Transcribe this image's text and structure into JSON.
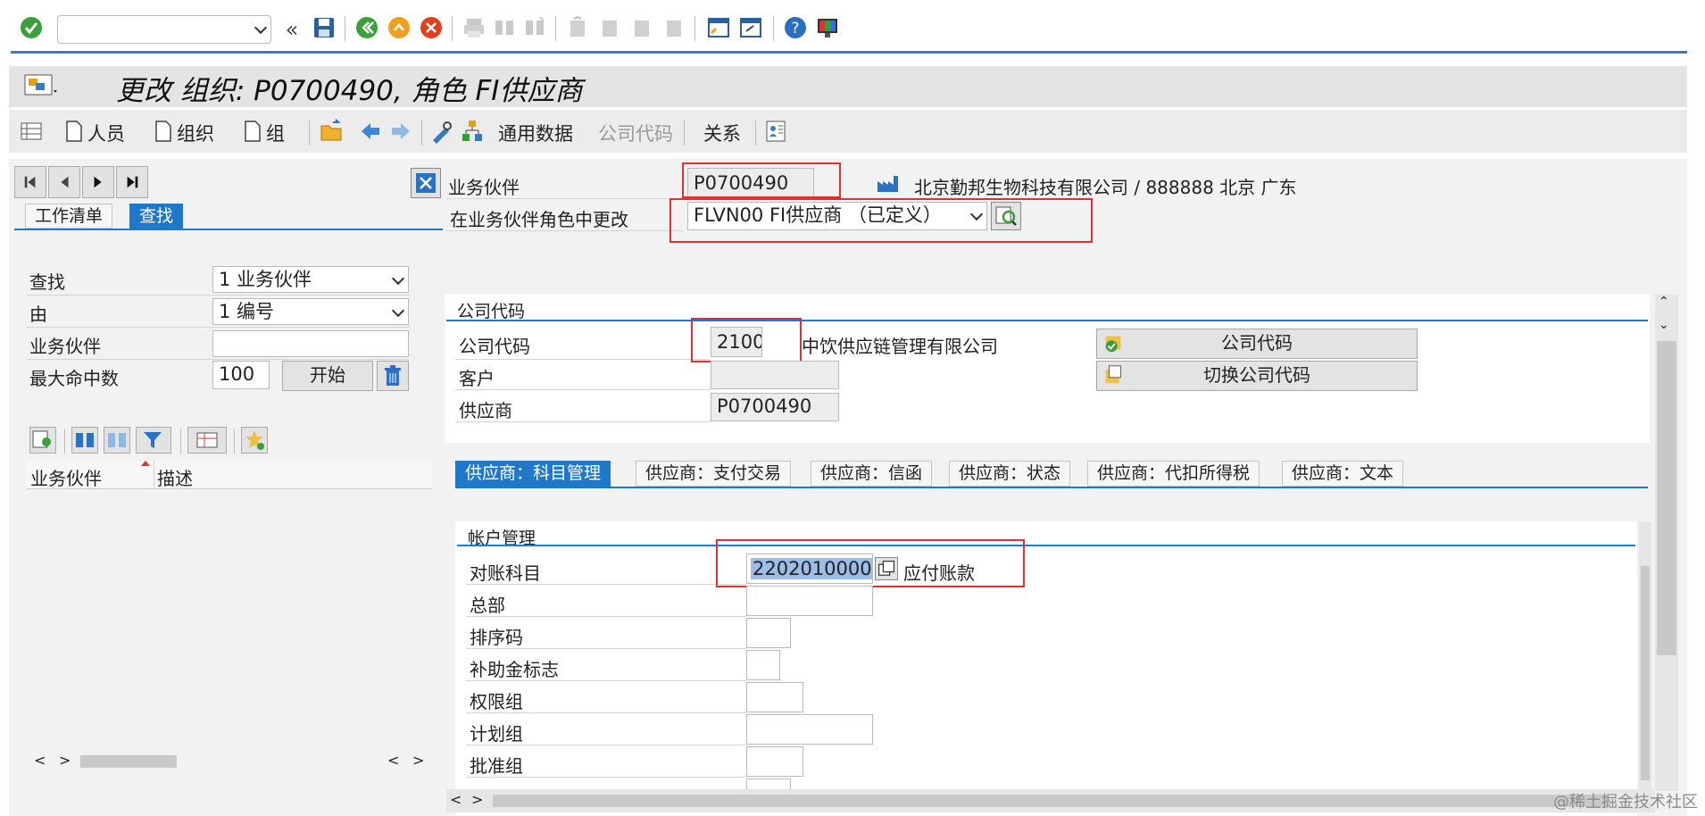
{
  "toolbar": {
    "command_placeholder": ""
  },
  "header": {
    "title": "更改 组织: P0700490, 角色 FI供应商"
  },
  "appbar": {
    "person": "人员",
    "org": "组织",
    "group": "组",
    "general_data": "通用数据",
    "company_code": "公司代码",
    "relations": "关系"
  },
  "left": {
    "tabs": [
      "工作清单",
      "查找"
    ],
    "find_label": "查找",
    "find_value": "1 业务伙伴",
    "by_label": "由",
    "by_value": "1 编号",
    "bp_label": "业务伙伴",
    "bp_value": "",
    "max_hits_label": "最大命中数",
    "max_hits_value": "100",
    "start_button": "开始",
    "col_bp": "业务伙伴",
    "col_desc": "描述"
  },
  "bp": {
    "label": "业务伙伴",
    "value": "P0700490",
    "name": "北京勤邦生物科技有限公司 / 888888 北京 广东",
    "role_label": "在业务伙伴角色中更改",
    "role_value": "FLVN00 FI供应商 （已定义）"
  },
  "company": {
    "section": "公司代码",
    "cc_label": "公司代码",
    "cc_value": "2100",
    "cc_name": "中饮供应链管理有限公司",
    "customer_label": "客户",
    "customer_value": "",
    "vendor_label": "供应商",
    "vendor_value": "P0700490",
    "btn_cc": "公司代码",
    "btn_switch": "切换公司代码"
  },
  "tabs": [
    "供应商：科目管理",
    "供应商：支付交易",
    "供应商：信函",
    "供应商：状态",
    "供应商：代扣所得税",
    "供应商：文本"
  ],
  "account": {
    "section": "帐户管理",
    "recon_label": "对账科目",
    "recon_value": "2202010000",
    "recon_desc": "应付账款",
    "hq_label": "总部",
    "sort_label": "排序码",
    "subsidy_label": "补助金标志",
    "auth_label": "权限组",
    "plan_label": "计划组",
    "approval_label": "批准组"
  },
  "watermark": "@稀土掘金技术社区"
}
